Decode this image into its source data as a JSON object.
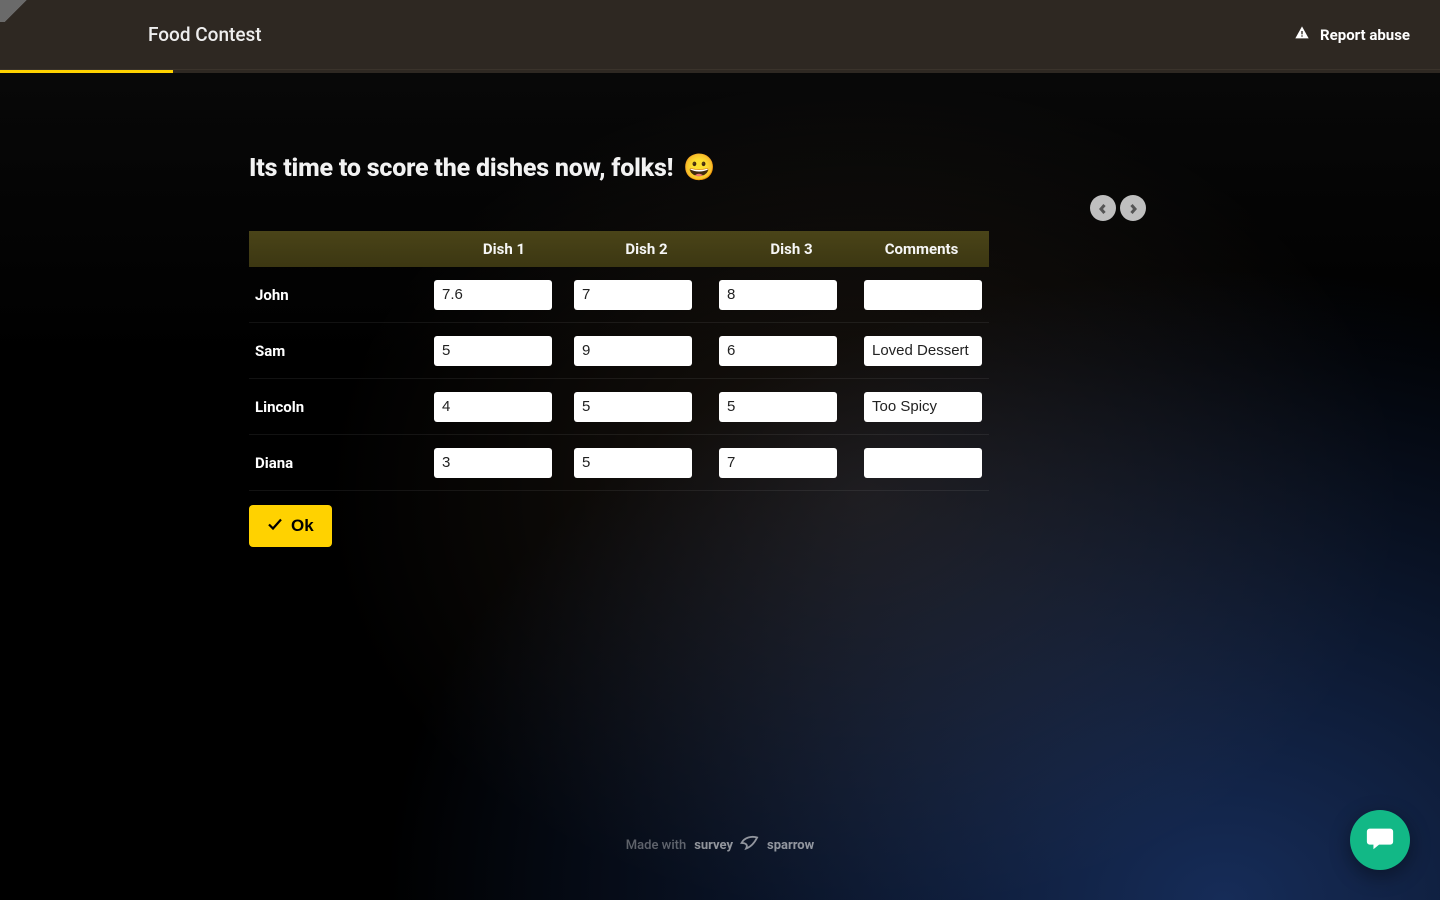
{
  "header": {
    "title": "Food Contest",
    "report_label": "Report abuse"
  },
  "progress": {
    "percent": 12,
    "track_color": "#2e2822",
    "fill_color": "#ffd200"
  },
  "question": {
    "text": "Its time to score the dishes now, folks!",
    "emoji": "😀"
  },
  "matrix": {
    "columns": [
      "Dish 1",
      "Dish 2",
      "Dish 3",
      "Comments"
    ],
    "rows": [
      {
        "label": "John",
        "values": [
          "7.6",
          "7",
          "8",
          ""
        ]
      },
      {
        "label": "Sam",
        "values": [
          "5",
          "9",
          "6",
          "Loved Dessert"
        ]
      },
      {
        "label": "Lincoln",
        "values": [
          "4",
          "5",
          "5",
          "Too Spicy"
        ]
      },
      {
        "label": "Diana",
        "values": [
          "3",
          "5",
          "7",
          ""
        ]
      }
    ]
  },
  "ok_label": "Ok",
  "footer": {
    "made_with": "Made with",
    "brand_left": "survey",
    "brand_right": "sparrow"
  },
  "icons": {
    "warning": "warning-icon",
    "check": "check-icon",
    "chevron_left": "chevron-left-icon",
    "chevron_right": "chevron-right-icon",
    "chat": "chat-icon",
    "sparrow": "sparrow-icon"
  },
  "colors": {
    "accent": "#ffd200",
    "chat": "#12b886"
  }
}
